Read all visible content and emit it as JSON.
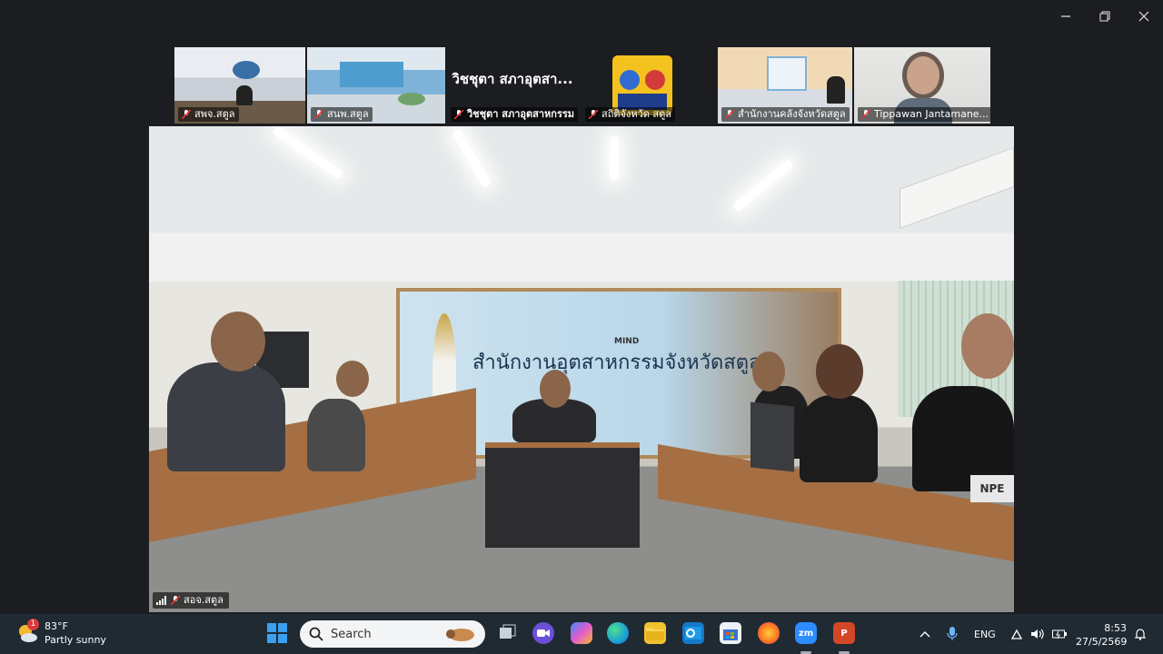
{
  "window": {
    "controls": [
      "minimize",
      "restore",
      "close"
    ]
  },
  "participants": [
    {
      "label": "สพจ.สตูล",
      "muted": true
    },
    {
      "label": "สนพ.สตูล",
      "muted": true
    },
    {
      "label": "วิชชุตา สภาอุตสาหกรรม",
      "display_name": "วิชชุตา สภาอุต​สา...",
      "muted": true
    },
    {
      "label": "สถิติจังหวัด สตูล",
      "muted": true
    },
    {
      "label": "สำนักงานคลังจังหวัดสตูล",
      "muted": true
    },
    {
      "label": "Tippawan Jantamane...",
      "muted": true
    }
  ],
  "main_video": {
    "label": "สอจ.สตูล",
    "muted": true,
    "banner_title": "สำนักงานอุตสาหกรรมจังหวัดสตูล",
    "banner_logo_text": "MIND",
    "device_label": "NPE"
  },
  "taskbar": {
    "weather": {
      "temp": "83°F",
      "condition": "Partly sunny",
      "badge": "1"
    },
    "search_placeholder": "Search",
    "apps": [
      {
        "name": "task-view",
        "color": "#c9d1d9"
      },
      {
        "name": "zoom-meetings",
        "color": "#6b4fd8"
      },
      {
        "name": "copilot",
        "color": "#3d8bf0"
      },
      {
        "name": "edge",
        "color": "#1ca0d8"
      },
      {
        "name": "file-explorer",
        "color": "#f2c230"
      },
      {
        "name": "outlook",
        "color": "#1479c8"
      },
      {
        "name": "store",
        "color": "#5a8fd0"
      },
      {
        "name": "firefox",
        "color": "#ff7a1f"
      },
      {
        "name": "zoom",
        "color": "#2d8cff",
        "text": "zm"
      },
      {
        "name": "powerpoint",
        "color": "#d24726",
        "text": "P"
      }
    ],
    "tray": {
      "language": "ENG"
    },
    "clock": {
      "time": "8:53",
      "date": "27/5/2569"
    }
  }
}
